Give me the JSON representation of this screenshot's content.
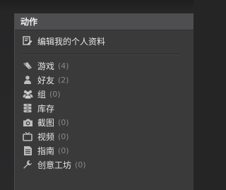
{
  "menu": {
    "title": "动作",
    "edit_profile": {
      "label": "编辑我的个人资料",
      "icon": "edit-profile-icon"
    },
    "items": [
      {
        "label": "游戏",
        "count": "(4)",
        "icon": "game-controller-icon"
      },
      {
        "label": "好友",
        "count": "(2)",
        "icon": "person-icon"
      },
      {
        "label": "组",
        "count": "(0)",
        "icon": "group-icon"
      },
      {
        "label": "库存",
        "count": "",
        "icon": "inventory-icon"
      },
      {
        "label": "截图",
        "count": "(0)",
        "icon": "camera-icon"
      },
      {
        "label": "视频",
        "count": "(0)",
        "icon": "tv-icon"
      },
      {
        "label": "指南",
        "count": "(0)",
        "icon": "document-icon"
      },
      {
        "label": "创意工坊",
        "count": "(0)",
        "icon": "wrench-icon"
      }
    ]
  },
  "colors": {
    "background": "#252526",
    "menu_bg": "#3a3a3b",
    "header_bg": "#4e4e50",
    "text": "#e6e6e6",
    "count_text": "#8a8a8a"
  }
}
